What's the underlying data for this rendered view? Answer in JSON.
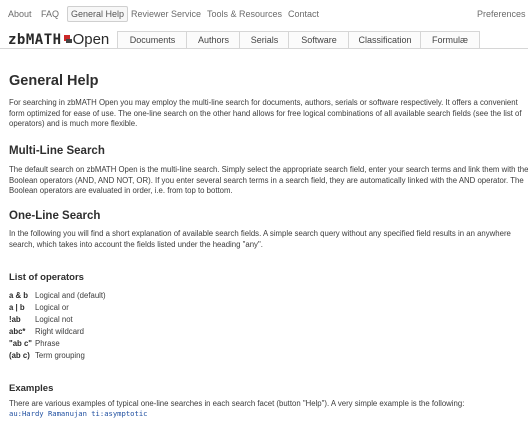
{
  "topnav": {
    "items": [
      "About",
      "FAQ",
      "General Help",
      "Reviewer Service",
      "Tools & Resources",
      "Contact"
    ],
    "preferences": "Preferences"
  },
  "logo": {
    "main": "zbMATH",
    "open": "Open"
  },
  "tabs": [
    "Documents",
    "Authors",
    "Serials",
    "Software",
    "Classification",
    "Formulæ"
  ],
  "main": {
    "title": "General Help",
    "intro": "For searching in zbMATH Open you may employ the multi-line search for documents, authors, serials or software respectively. It offers a convenient form optimized for ease of use. The one-line search on the other hand allows for free logical combinations of all available search fields (see the list of operators) and is much more flexible.",
    "multiline_heading": "Multi-Line Search",
    "multiline_text": "The default search on zbMATH Open is the multi-line search. Simply select the appropriate search field, enter your search terms and link them with the Boolean operators (AND, AND NOT, OR). If you enter several search terms in a search field, they are automatically linked with the AND operator. The Boolean operators are evaluated in order, i.e. from top to bottom.",
    "oneline_heading": "One-Line Search",
    "oneline_text": "In the following you will find a short explanation of available search fields. A simple search query without any specified field results in an anywhere search, which takes into account the fields listed under the heading \"any\".",
    "operators_heading": "List of operators",
    "operators": [
      {
        "sym": "a & b",
        "desc": "Logical and (default)"
      },
      {
        "sym": "a | b",
        "desc": "Logical or"
      },
      {
        "sym": "!ab",
        "desc": "Logical not"
      },
      {
        "sym": "abc*",
        "desc": "Right wildcard"
      },
      {
        "sym": "\"ab c\"",
        "desc": "Phrase"
      },
      {
        "sym": "(ab c)",
        "desc": "Term grouping"
      }
    ],
    "examples_heading": "Examples",
    "examples_text": "There are various examples of typical one-line searches in each search facet (button \"Help\"). A very simple example is the following:",
    "example_query": "au:Hardy Ramanujan ti:asymptotic"
  }
}
